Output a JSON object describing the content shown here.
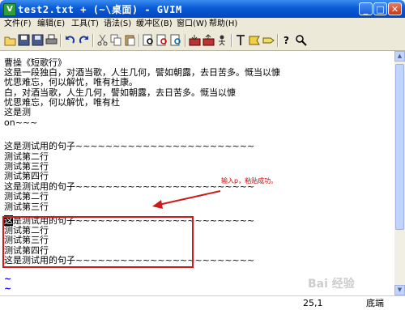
{
  "window": {
    "title": "test2.txt + (~\\桌面) - GVIM",
    "app_icon_letter": "V",
    "controls": {
      "minimize": "_",
      "maximize": "□",
      "close": "✕"
    }
  },
  "menu": {
    "items": [
      "文件(F)",
      "编辑(E)",
      "工具(T)",
      "语法(S)",
      "缓冲区(B)",
      "窗口(W)",
      "帮助(H)"
    ]
  },
  "toolbar": {
    "icons": [
      "open-icon",
      "save-icon",
      "save-all-icon",
      "print-icon",
      "undo-icon",
      "redo-icon",
      "cut-icon",
      "copy-icon",
      "paste-icon",
      "find-replace-icon",
      "find-next-icon",
      "find-prev-icon",
      "load-session-icon",
      "save-session-icon",
      "run-script-icon",
      "make-icon",
      "shell-icon",
      "make-tags-icon",
      "jump-tag-icon",
      "help-icon",
      "find-help-icon"
    ]
  },
  "editor": {
    "lines": [
      "曹操《短歌行》",
      "这是一段独白，对酒当歌，人生几何，譬如朝露，去日苦多。慨当以慷",
      "忧思难忘，何以解忧，唯有杜康。",
      "白，对酒当歌，人生几何，譬如朝露，去日苦多。慨当以慷",
      "忧思难忘，何以解忧，唯有杜",
      "这是测",
      " on~~~",
      "",
      "这是测试用的句子~~~~~~~~~~~~~~~~~~~~~~~~",
      "测试第二行",
      "测试第三行",
      "测试第四行",
      "这是测试用的句子~~~~~~~~~~~~~~~~~~~~~~~~",
      "测试第二行",
      "测试第三行",
      "这是测试用的句子~~~~~~~~~~~~~~~~~~~~~~~~",
      "测试第二行",
      "测试第三行",
      "测试第四行",
      "这是测试用的句子~~~~~~~~~~~~~~~~~~~~~~~~",
      "",
      "~",
      "~"
    ],
    "cursor_char": "这"
  },
  "annotation": {
    "note": "输入p，粘贴成功。",
    "arrow_color": "#cc1b1b"
  },
  "status": {
    "position": "25,1",
    "scroll": "底端"
  },
  "watermark": "Bai 经验",
  "colors": {
    "title_bar": "#0a5bd6",
    "tilde": "#0000c0",
    "annotation_red": "#cc1b1b"
  }
}
